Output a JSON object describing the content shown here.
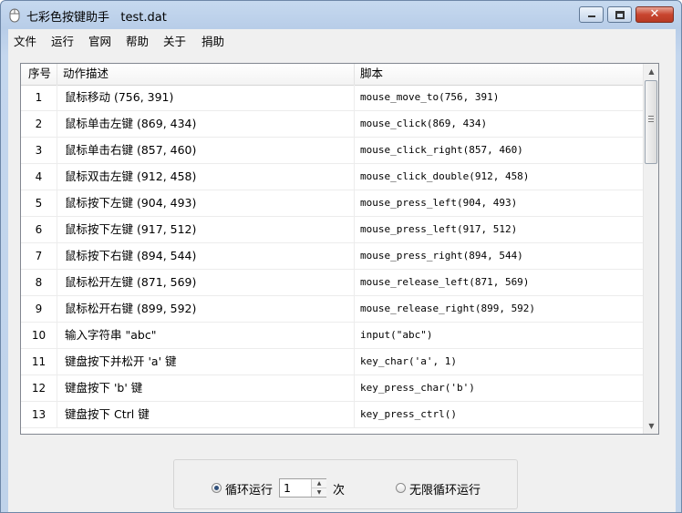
{
  "window": {
    "title": "七彩色按键助手   test.dat",
    "min_glyph": "",
    "close_glyph": "✕"
  },
  "menu": [
    "文件",
    "运行",
    "官网",
    "帮助",
    "关于",
    "捐助"
  ],
  "table": {
    "columns": [
      "序号",
      "动作描述",
      "脚本"
    ],
    "rows": [
      {
        "num": "1",
        "desc": "鼠标移动 (756, 391)",
        "script": "mouse_move_to(756, 391)"
      },
      {
        "num": "2",
        "desc": "鼠标单击左键 (869, 434)",
        "script": "mouse_click(869, 434)"
      },
      {
        "num": "3",
        "desc": "鼠标单击右键 (857, 460)",
        "script": "mouse_click_right(857, 460)"
      },
      {
        "num": "4",
        "desc": "鼠标双击左键 (912, 458)",
        "script": "mouse_click_double(912, 458)"
      },
      {
        "num": "5",
        "desc": "鼠标按下左键 (904, 493)",
        "script": "mouse_press_left(904, 493)"
      },
      {
        "num": "6",
        "desc": "鼠标按下左键 (917, 512)",
        "script": "mouse_press_left(917, 512)"
      },
      {
        "num": "7",
        "desc": "鼠标按下右键 (894, 544)",
        "script": "mouse_press_right(894, 544)"
      },
      {
        "num": "8",
        "desc": "鼠标松开左键 (871, 569)",
        "script": "mouse_release_left(871, 569)"
      },
      {
        "num": "9",
        "desc": "鼠标松开右键 (899, 592)",
        "script": "mouse_release_right(899, 592)"
      },
      {
        "num": "10",
        "desc": "输入字符串 \"abc\"",
        "script": "input(\"abc\")"
      },
      {
        "num": "11",
        "desc": "键盘按下并松开 'a' 键",
        "script": "key_char('a', 1)"
      },
      {
        "num": "12",
        "desc": "键盘按下 'b' 键",
        "script": "key_press_char('b')"
      },
      {
        "num": "13",
        "desc": "键盘按下 Ctrl 键",
        "script": "key_press_ctrl()"
      }
    ]
  },
  "scrollbar": {
    "up": "▲",
    "down": "▼"
  },
  "options": {
    "loop_label": "循环运行",
    "loop_checked": true,
    "count_value": "1",
    "times_label": "次",
    "infinite_label": "无限循环运行",
    "infinite_checked": false,
    "spin_up": "▲",
    "spin_down": "▼"
  }
}
